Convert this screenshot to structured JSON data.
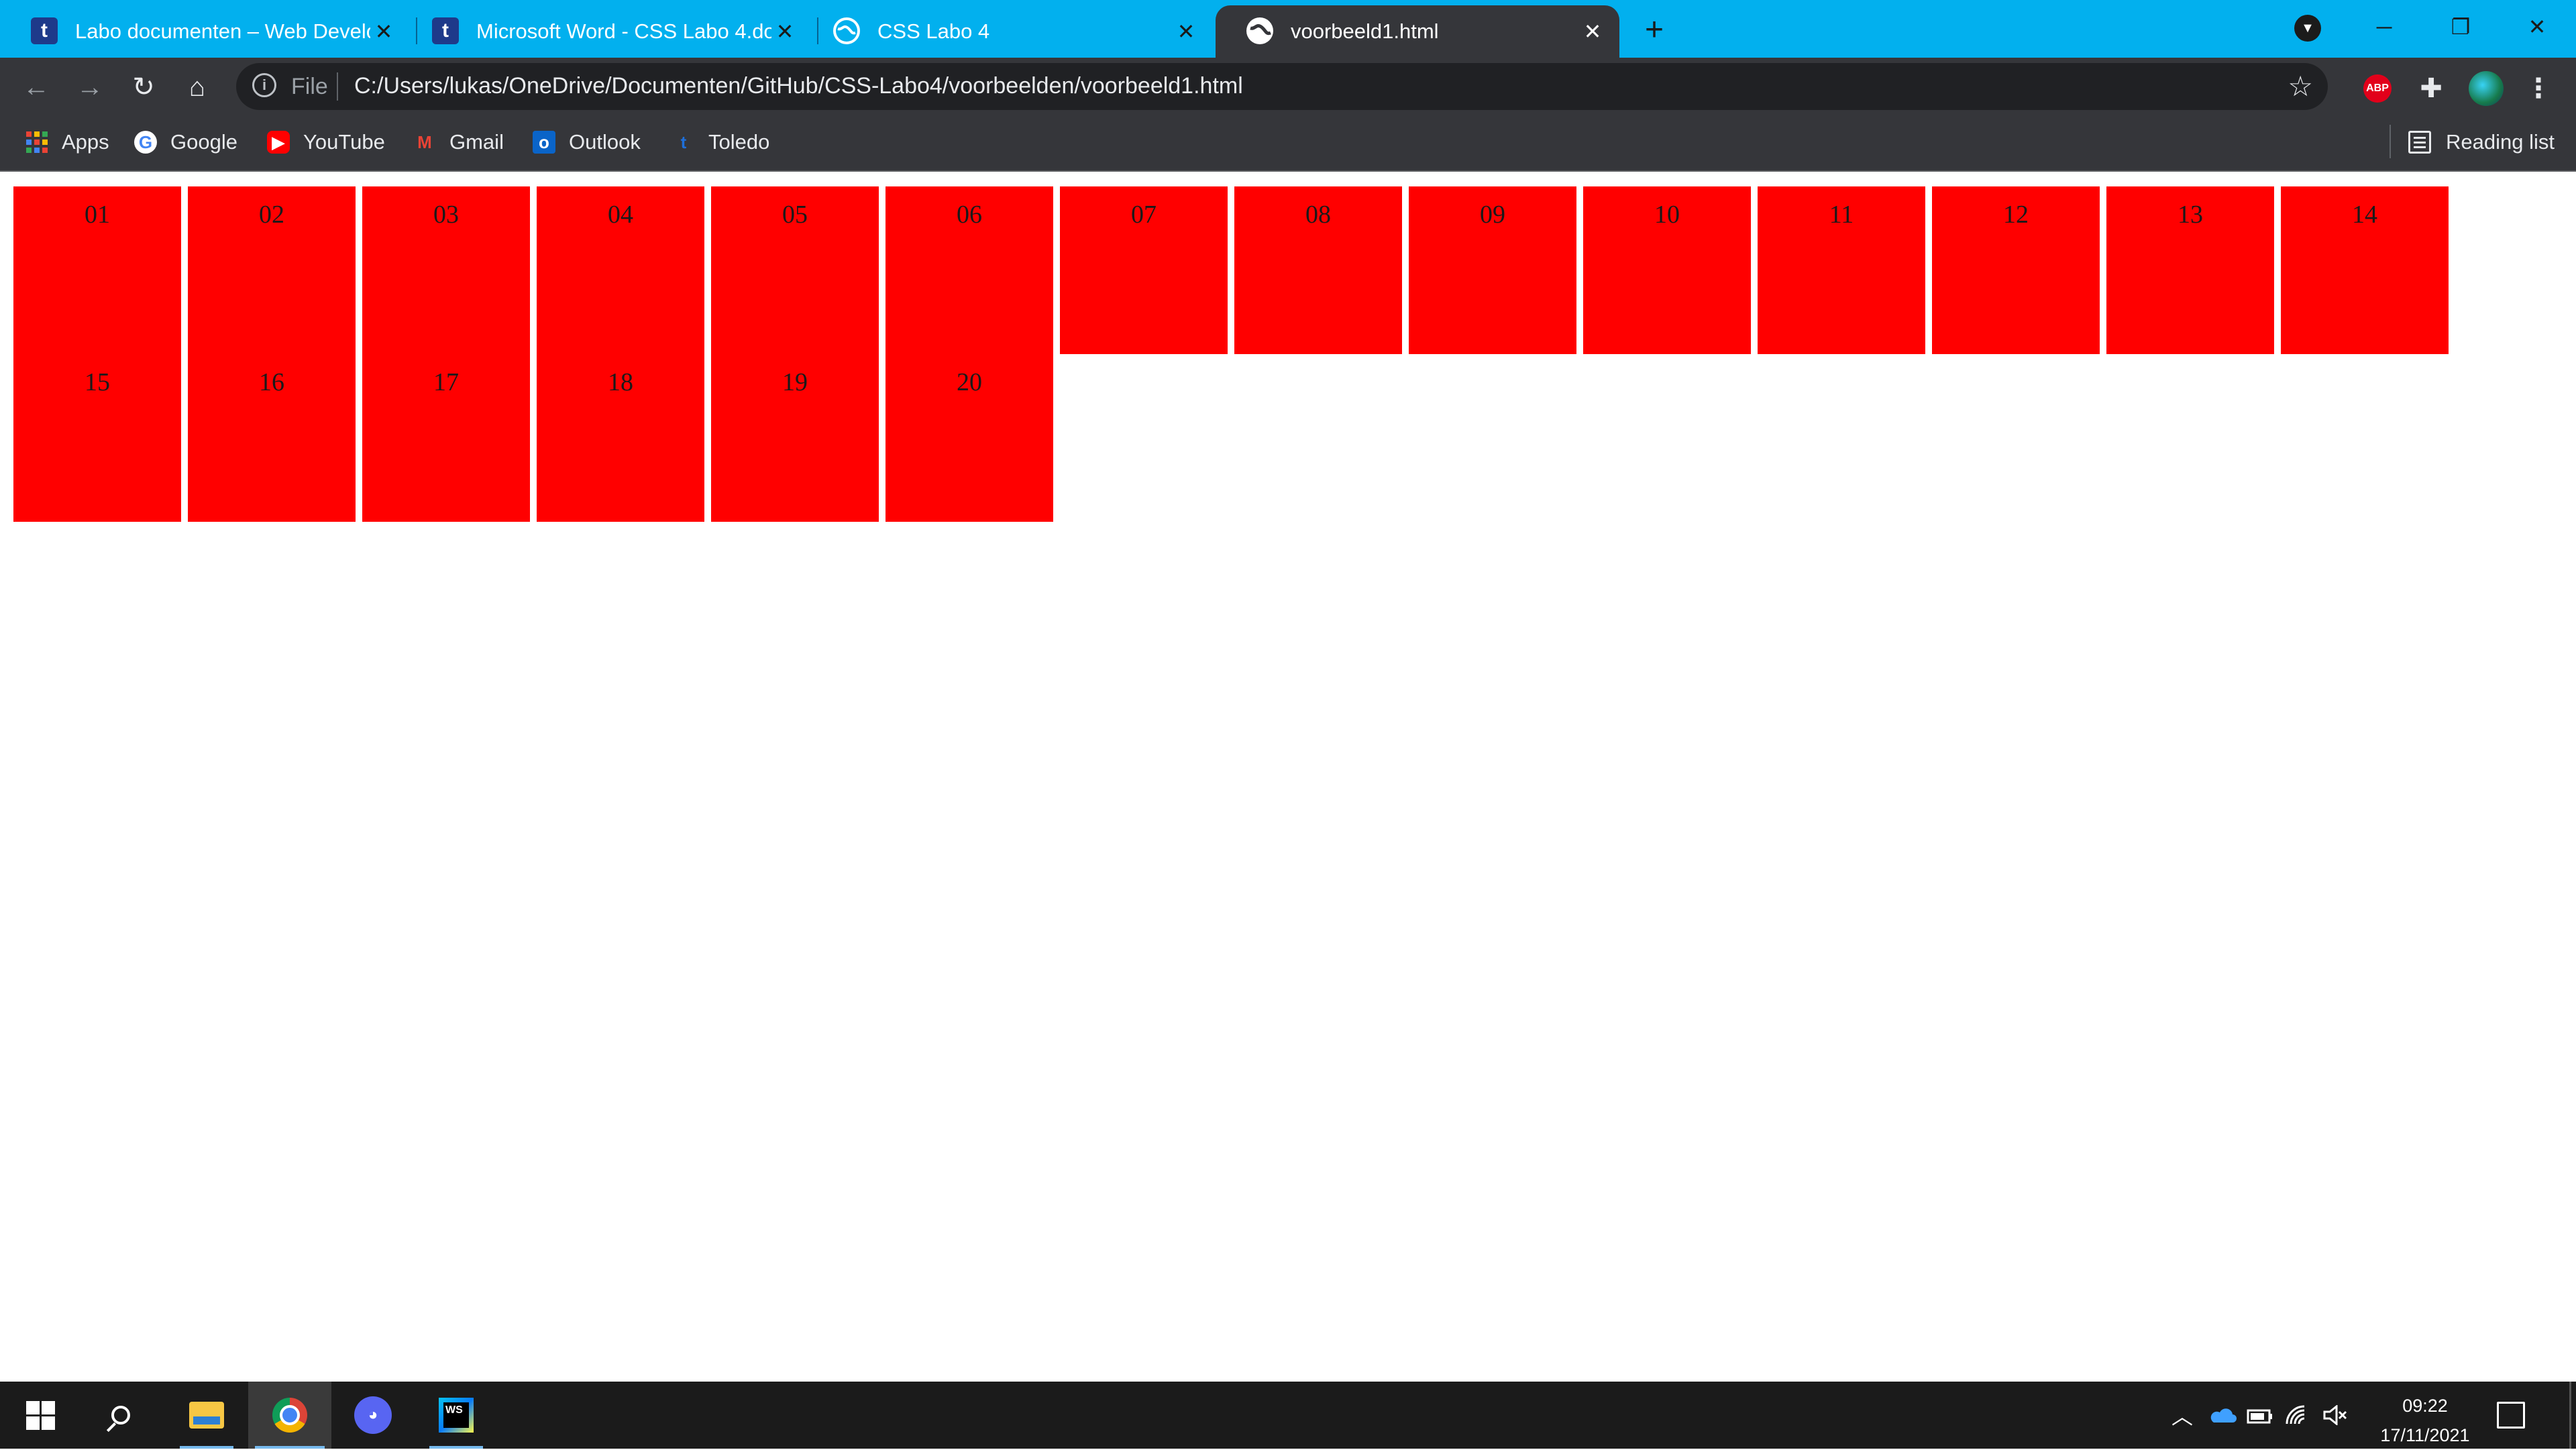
{
  "browser": {
    "tabs": [
      {
        "title": "Labo documenten – Web Develo",
        "favicon": "toledo-t-icon",
        "active": false
      },
      {
        "title": "Microsoft Word - CSS Labo 4.do",
        "favicon": "toledo-t-icon",
        "active": false
      },
      {
        "title": "CSS Labo 4",
        "favicon": "globe-icon",
        "active": false
      },
      {
        "title": "voorbeeld1.html",
        "favicon": "globe-icon",
        "active": true
      }
    ],
    "address": {
      "scheme_label": "File",
      "url": "C:/Users/lukas/OneDrive/Documenten/GitHub/CSS-Labo4/voorbeelden/voorbeeld1.html"
    },
    "bookmarks": [
      {
        "label": "Apps",
        "icon": "apps-grid-icon"
      },
      {
        "label": "Google",
        "icon": "google-icon"
      },
      {
        "label": "YouTube",
        "icon": "youtube-icon"
      },
      {
        "label": "Gmail",
        "icon": "gmail-icon"
      },
      {
        "label": "Outlook",
        "icon": "outlook-icon"
      },
      {
        "label": "Toledo",
        "icon": "toledo-t-icon"
      }
    ],
    "reading_list": "Reading list",
    "extensions": [
      {
        "name": "adblock-plus-icon",
        "text": "ABP"
      },
      {
        "name": "extensions-puzzle-icon"
      },
      {
        "name": "profile-avatar"
      }
    ],
    "colors": {
      "tab_strip": "#02b0ee",
      "toolbar": "#35363a",
      "omnibox": "#202124"
    }
  },
  "page": {
    "box_color": "#ff0000",
    "boxes": [
      "01",
      "02",
      "03",
      "04",
      "05",
      "06",
      "07",
      "08",
      "09",
      "10",
      "11",
      "12",
      "13",
      "14",
      "15",
      "16",
      "17",
      "18",
      "19",
      "20"
    ]
  },
  "taskbar": {
    "apps": [
      {
        "name": "start-button"
      },
      {
        "name": "search-button"
      },
      {
        "name": "file-explorer"
      },
      {
        "name": "chrome",
        "active": true
      },
      {
        "name": "discord"
      },
      {
        "name": "webstorm"
      }
    ],
    "time": "09:22",
    "date": "17/11/2021"
  }
}
